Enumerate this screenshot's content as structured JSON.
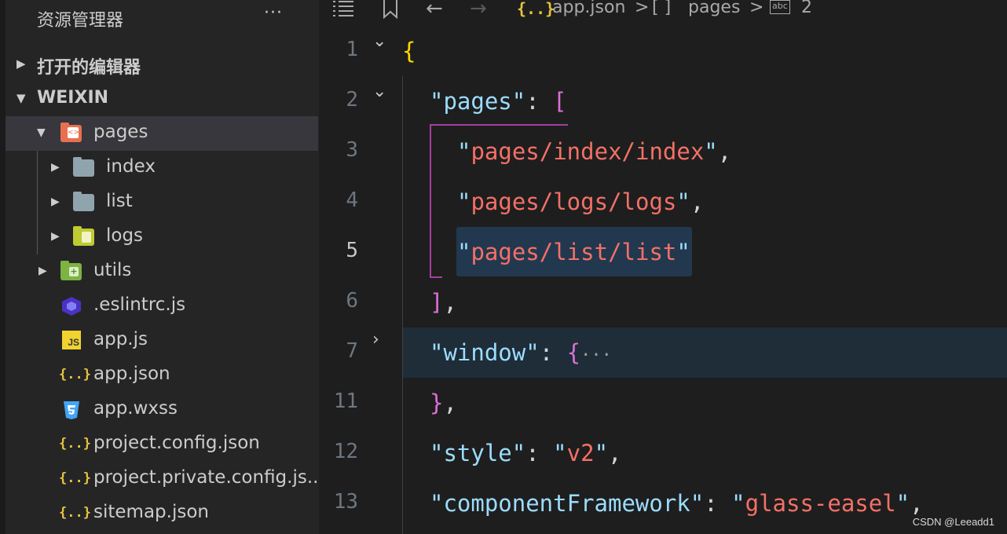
{
  "explorer": {
    "title": "资源管理器",
    "more_label": "···",
    "sections": [
      {
        "label": "打开的编辑器",
        "expanded": false
      },
      {
        "label": "WEIXIN",
        "expanded": true
      }
    ],
    "tree": [
      {
        "name": "pages",
        "icon": "folder-pages-icon",
        "expanded": true,
        "selected": true
      },
      {
        "name": "index",
        "icon": "folder-icon"
      },
      {
        "name": "list",
        "icon": "folder-icon"
      },
      {
        "name": "logs",
        "icon": "folder-logs-icon"
      },
      {
        "name": "utils",
        "icon": "folder-utils-icon"
      },
      {
        "name": ".eslintrc.js",
        "icon": "eslint-icon"
      },
      {
        "name": "app.js",
        "icon": "js-icon",
        "icon_text": "JS"
      },
      {
        "name": "app.json",
        "icon": "json-icon",
        "icon_text": "{..}"
      },
      {
        "name": "app.wxss",
        "icon": "css-icon"
      },
      {
        "name": "project.config.json",
        "icon": "json-icon",
        "icon_text": "{..}"
      },
      {
        "name": "project.private.config.js...",
        "icon": "json-icon",
        "icon_text": "{..}"
      },
      {
        "name": "sitemap.json",
        "icon": "json-icon",
        "icon_text": "{..}"
      }
    ]
  },
  "breadcrumb": {
    "json_icon_text": "{..}",
    "file": "app.json",
    "sep": ">",
    "array_icon_text": "[ ]",
    "segment": "pages",
    "abc_icon_text": "abc",
    "index": "2"
  },
  "editor": {
    "lines": [
      {
        "n": "1"
      },
      {
        "n": "2"
      },
      {
        "n": "3"
      },
      {
        "n": "4"
      },
      {
        "n": "5"
      },
      {
        "n": "6"
      },
      {
        "n": "7"
      },
      {
        "n": "11"
      },
      {
        "n": "12"
      },
      {
        "n": "13"
      }
    ],
    "active_line": "5",
    "tokens": {
      "open_brace": "{",
      "pages_key": "pages",
      "quote": "\"",
      "colon": ": ",
      "open_bracket": "[",
      "item1": "pages/index/index",
      "item2": "pages/logs/logs",
      "item3": "pages/list/list",
      "comma": ",",
      "close_bracket": "]",
      "window_key": "window",
      "ellipsis": "···",
      "close_brace": "}",
      "style_key": "style",
      "style_val": "v2",
      "cf_key": "componentFramework",
      "cf_val": "glass-easel"
    }
  },
  "watermark": "CSDN @Leeadd1",
  "colors": {
    "sidebar_bg": "#252526",
    "editor_bg": "#1e1e1e",
    "string": "#f47067",
    "key": "#9cdcfe",
    "bracket_gold": "#ffd700",
    "bracket_purple": "#da70d6",
    "bracket_blue": "#179fff"
  }
}
